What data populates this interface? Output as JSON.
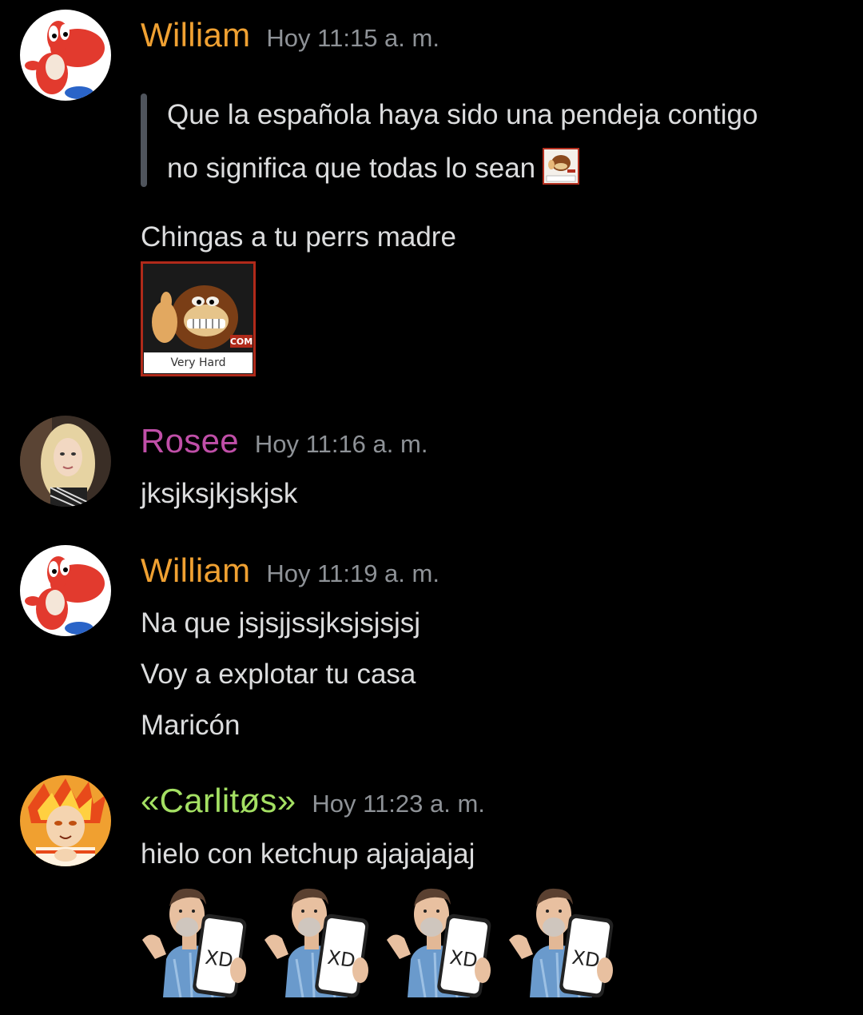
{
  "messages": [
    {
      "username": "William",
      "username_color": "#f0a132",
      "timestamp": "Hoy 11:15 a. m.",
      "avatar": "red-yoshi-avatar",
      "quote_lines": [
        "Que la española haya sido una pendeja contigo",
        "no significa que todas lo sean"
      ],
      "lines": [
        "Chingas a tu perrs madre"
      ],
      "emoji": "donkey-kong-very-hard-emoji",
      "emoji_label": "Very Hard"
    },
    {
      "username": "Rosee",
      "username_color": "#c04fa8",
      "timestamp": "Hoy 11:16 a. m.",
      "avatar": "blonde-woman-avatar",
      "lines": [
        "jksjksjkjskjsk"
      ]
    },
    {
      "username": "William",
      "username_color": "#f0a132",
      "timestamp": "Hoy 11:19 a. m.",
      "avatar": "red-yoshi-avatar",
      "lines": [
        "Na que jsjsjjssjksjsjsjsj",
        "Voy a explotar tu casa",
        "Maricón"
      ]
    },
    {
      "username": "«Carlitøs»",
      "username_color": "#a4e063",
      "timestamp": "Hoy 11:23 a. m.",
      "avatar": "anime-fire-hair-avatar",
      "lines": [
        "hielo con ketchup ajajajajaj"
      ],
      "sticker": "man-holding-xd-phone-sticker",
      "sticker_text": "XD",
      "sticker_count": 4
    }
  ],
  "colors": {
    "background": "#000000",
    "text": "#dcddde",
    "timestamp": "#8e9297",
    "quote_bar": "#4f545c"
  }
}
